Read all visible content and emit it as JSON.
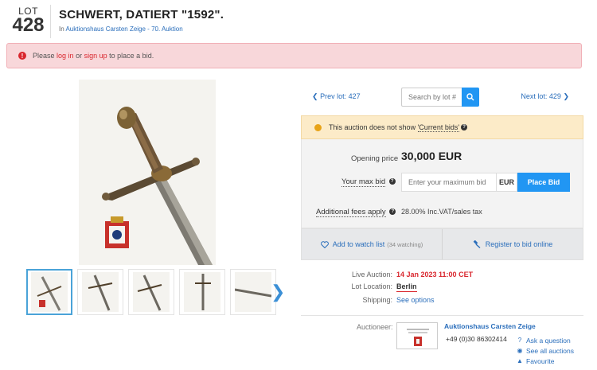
{
  "lot": {
    "word": "LOT",
    "number": "428",
    "title": "SCHWERT, DATIERT \"1592\".",
    "sub_prefix": "In",
    "auction_link": "Auktionshaus Carsten Zeige - 70. Auktion"
  },
  "alert": {
    "icon": "!",
    "before": "Please",
    "login": "log in",
    "or": "or",
    "signup": "sign up",
    "after": "to place a bid."
  },
  "nav": {
    "prev": "Prev lot: 427",
    "next": "Next lot: 429",
    "search_placeholder": "Search by lot #"
  },
  "notice": {
    "text": "This auction does not show",
    "highlight": "'Current bids'"
  },
  "bid": {
    "opening_label": "Opening price",
    "opening_value": "30,000 EUR",
    "max_bid_label": "Your max bid",
    "max_bid_placeholder": "Enter your maximum bid",
    "currency": "EUR",
    "place_bid": "Place Bid",
    "fees_label": "Additional fees apply",
    "fees_value": "28.00% Inc.VAT/sales tax"
  },
  "actions": {
    "watch": "Add to watch list",
    "watch_count": "(34 watching)",
    "register": "Register to bid online"
  },
  "info": {
    "live_label": "Live Auction:",
    "live_value": "14 Jan 2023 11:00 CET",
    "location_label": "Lot Location:",
    "location_value": "Berlin",
    "shipping_label": "Shipping:",
    "shipping_value": "See options"
  },
  "auctioneer": {
    "label": "Auctioneer:",
    "name": "Auktionshaus Carsten Zeige",
    "phone": "+49 (0)30 86302414",
    "ask": "Ask a question",
    "see_all": "See all auctions",
    "favourite": "Favourite"
  },
  "colors": {
    "accent": "#2196f3",
    "link": "#2a6ebb",
    "alert_bg": "#f8d7da",
    "notice_bg": "#fcebc8",
    "live_date": "#d9272e"
  },
  "icons": {
    "prev": "chevron-left-icon",
    "next": "chevron-right-icon",
    "search": "search-icon",
    "watch": "heart-icon",
    "register": "hammer-icon",
    "ask": "question-icon",
    "see_all": "eye-icon",
    "favourite": "bell-icon"
  }
}
